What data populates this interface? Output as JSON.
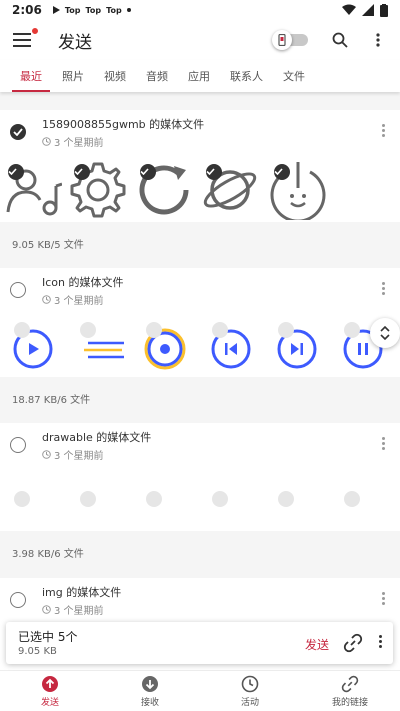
{
  "status_bar": {
    "time": "2:06",
    "notifications": [
      "Top",
      "Top",
      "Top"
    ]
  },
  "app_bar": {
    "title": "发送"
  },
  "tabs": [
    {
      "label": "最近",
      "active": true
    },
    {
      "label": "照片",
      "active": false
    },
    {
      "label": "视频",
      "active": false
    },
    {
      "label": "音频",
      "active": false
    },
    {
      "label": "应用",
      "active": false
    },
    {
      "label": "联系人",
      "active": false
    },
    {
      "label": "文件",
      "active": false
    }
  ],
  "groups": [
    {
      "name": "1589008855gwmb 的媒体文件",
      "time": "3 个星期前",
      "selected": true,
      "size_text": "9.05 KB/5 文件",
      "items": [
        "user-music-icon",
        "gear-icon",
        "refresh-icon",
        "planet-icon",
        "power-robot-icon"
      ]
    },
    {
      "name": "Icon 的媒体文件",
      "time": "3 个星期前",
      "selected": false,
      "size_text": "18.87 KB/6 文件",
      "items": [
        "play-circle-icon",
        "menu-lines-icon",
        "stop-circle-icon",
        "skip-previous-icon",
        "skip-next-icon",
        "pause-circle-icon"
      ]
    },
    {
      "name": "drawable 的媒体文件",
      "time": "3 个星期前",
      "selected": false,
      "size_text": "3.98 KB/6 文件",
      "items": []
    },
    {
      "name": "img 的媒体文件",
      "time": "3 个星期前",
      "selected": false,
      "size_text": "",
      "items": []
    }
  ],
  "selection_bar": {
    "count_label": "已选中 5个",
    "size_label": "9.05 KB",
    "send_label": "发送"
  },
  "bottom_nav": [
    {
      "label": "发送",
      "icon": "upload-circle-icon",
      "active": true
    },
    {
      "label": "接收",
      "icon": "download-circle-icon",
      "active": false
    },
    {
      "label": "活动",
      "icon": "clock-icon",
      "active": false
    },
    {
      "label": "我的链接",
      "icon": "link-icon",
      "active": false
    }
  ],
  "colors": {
    "accent": "#c62840",
    "icon_blue": "#3d5afe",
    "icon_yellow": "#fbc02d",
    "icon_gray": "#666666"
  }
}
